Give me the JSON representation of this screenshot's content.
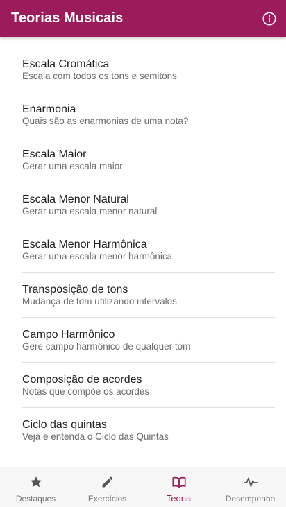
{
  "colors": {
    "primary": "#9c1b5a",
    "appbar_text": "#ffffff",
    "title_text": "#212121",
    "subtitle_text": "#6b6b6b",
    "nav_inactive": "#757575"
  },
  "appbar": {
    "title": "Teorias Musicais",
    "info_icon": "info-icon"
  },
  "list": {
    "items": [
      {
        "title": "Escala Cromática",
        "subtitle": "Escala com todos os tons e semitons"
      },
      {
        "title": "Enarmonia",
        "subtitle": "Quais são as enarmonias de uma nota?"
      },
      {
        "title": "Escala Maior",
        "subtitle": "Gerar uma escala maior"
      },
      {
        "title": "Escala Menor Natural",
        "subtitle": "Gerar uma escala menor natural"
      },
      {
        "title": "Escala Menor Harmônica",
        "subtitle": "Gerar uma escala menor harmônica"
      },
      {
        "title": "Transposição de tons",
        "subtitle": "Mudança de tom utilizando intervalos"
      },
      {
        "title": "Campo Harmônico",
        "subtitle": "Gere campo harmônico de qualquer tom"
      },
      {
        "title": "Composição de acordes",
        "subtitle": "Notas que compõe os acordes"
      },
      {
        "title": "Ciclo das quintas",
        "subtitle": "Veja e entenda o Ciclo das Quintas"
      }
    ]
  },
  "bottom_nav": {
    "items": [
      {
        "label": "Destaques",
        "icon": "star-icon",
        "active": false
      },
      {
        "label": "Exercícios",
        "icon": "pencil-icon",
        "active": false
      },
      {
        "label": "Teoria",
        "icon": "book-icon",
        "active": true
      },
      {
        "label": "Desempenho",
        "icon": "pulse-icon",
        "active": false
      }
    ]
  }
}
